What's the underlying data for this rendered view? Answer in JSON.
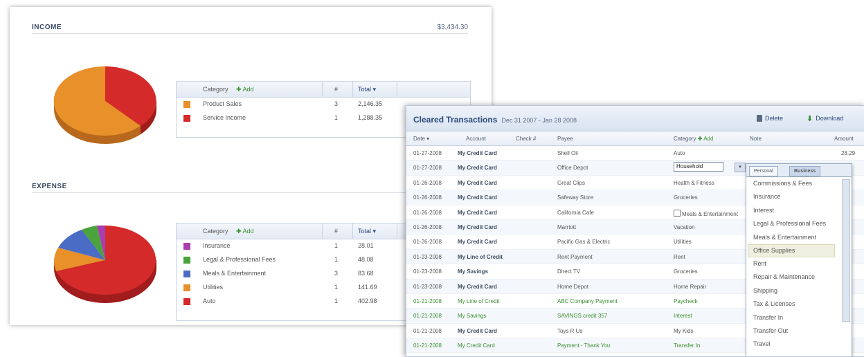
{
  "income": {
    "title": "INCOME",
    "total": "$3,434.30",
    "table": {
      "headers": {
        "category": "Category",
        "add": "Add",
        "count": "#",
        "total": "Total"
      },
      "rows": [
        {
          "name": "Product Sales",
          "count": "3",
          "total": "2,146.35",
          "color": "#e8902a"
        },
        {
          "name": "Service Income",
          "count": "1",
          "total": "1,288.35",
          "color": "#d42a2a"
        }
      ]
    }
  },
  "expense": {
    "title": "EXPENSE",
    "table": {
      "headers": {
        "category": "Category",
        "add": "Add",
        "count": "#",
        "total": "Total"
      },
      "rows": [
        {
          "name": "Insurance",
          "count": "1",
          "total": "28.01",
          "color": "#a83cb0"
        },
        {
          "name": "Legal & Professional Fees",
          "count": "1",
          "total": "48.08",
          "color": "#4aa33c"
        },
        {
          "name": "Meals & Entertainment",
          "count": "3",
          "total": "83.68",
          "color": "#4a6cc4"
        },
        {
          "name": "Utilities",
          "count": "1",
          "total": "141.69",
          "color": "#e8902a"
        },
        {
          "name": "Auto",
          "count": "1",
          "total": "402.98",
          "color": "#d42a2a"
        }
      ]
    }
  },
  "transactions": {
    "title": "Cleared Transactions",
    "range": "Dec 31 2007 - Jan 28 2008",
    "buttons": {
      "delete": "Delete",
      "download": "Download"
    },
    "columns": {
      "date": "Date",
      "account": "Account",
      "check": "Check #",
      "payee": "Payee",
      "category": "Category",
      "add": "Add",
      "note": "Note",
      "amount": "Amount"
    },
    "rows": [
      {
        "date": "01-27-2008",
        "account": "My Credit Card",
        "payee": "Shell Oil",
        "category": "Auto",
        "amount": "28.29",
        "green": false
      },
      {
        "date": "01-27-2008",
        "account": "My Credit Card",
        "payee": "Office Depot",
        "category": "",
        "amount": "",
        "green": false,
        "editing": true
      },
      {
        "date": "01-26-2008",
        "account": "My Credit Card",
        "payee": "Great Clips",
        "category": "Health & Fitness",
        "amount": "",
        "green": false
      },
      {
        "date": "01-26-2008",
        "account": "My Credit Card",
        "payee": "Safeway Store",
        "category": "Groceries",
        "amount": "",
        "green": false
      },
      {
        "date": "01-26-2008",
        "account": "My Credit Card",
        "payee": "California Cafe",
        "category": "Meals & Entertainment",
        "amount": "",
        "green": false
      },
      {
        "date": "01-26-2008",
        "account": "My Credit Card",
        "payee": "Marriott",
        "category": "Vacation",
        "amount": "",
        "green": false
      },
      {
        "date": "01-26-2008",
        "account": "My Credit Card",
        "payee": "Pacific Gas & Electric",
        "category": "Utilities",
        "amount": "",
        "green": false
      },
      {
        "date": "01-23-2008",
        "account": "My Line of Credit",
        "payee": "Rent Payment",
        "category": "Rent",
        "amount": "",
        "green": false
      },
      {
        "date": "01-23-2008",
        "account": "My Savings",
        "payee": "Direct TV",
        "category": "Groceries",
        "amount": "",
        "green": false
      },
      {
        "date": "01-23-2008",
        "account": "My Credit Card",
        "payee": "Home Depot",
        "category": "Home Repair",
        "amount": "",
        "green": false
      },
      {
        "date": "01-21-2008",
        "account": "My Line of Credit",
        "payee": "ABC Company Payment",
        "category": "Paycheck",
        "amount": "",
        "green": true
      },
      {
        "date": "01-21-2008",
        "account": "My Savings",
        "payee": "SAVINGS credit 357",
        "category": "Interest",
        "amount": "",
        "green": true
      },
      {
        "date": "01-21-2008",
        "account": "My Credit Card",
        "payee": "Toys R Us",
        "category": "My Kids",
        "amount": "",
        "green": false
      },
      {
        "date": "01-21-2008",
        "account": "My Credit Card",
        "payee": "Payment - Thank You",
        "category": "Transfer In",
        "amount": "",
        "green": true
      }
    ],
    "editing_value": "Household",
    "dropdown": {
      "tabs": [
        "Personal",
        "Business"
      ],
      "active_tab": "Business",
      "items": [
        "Commissions & Fees",
        "Insurance",
        "Interest",
        "Legal & Professional Fees",
        "Meals & Entertainment",
        "Office Supplies",
        "Rent",
        "Repair & Maintenance",
        "Shipping",
        "Tax & Licenses",
        "Transfer In",
        "Transfer Out",
        "Travel"
      ],
      "highlighted": "Office Supplies"
    }
  }
}
